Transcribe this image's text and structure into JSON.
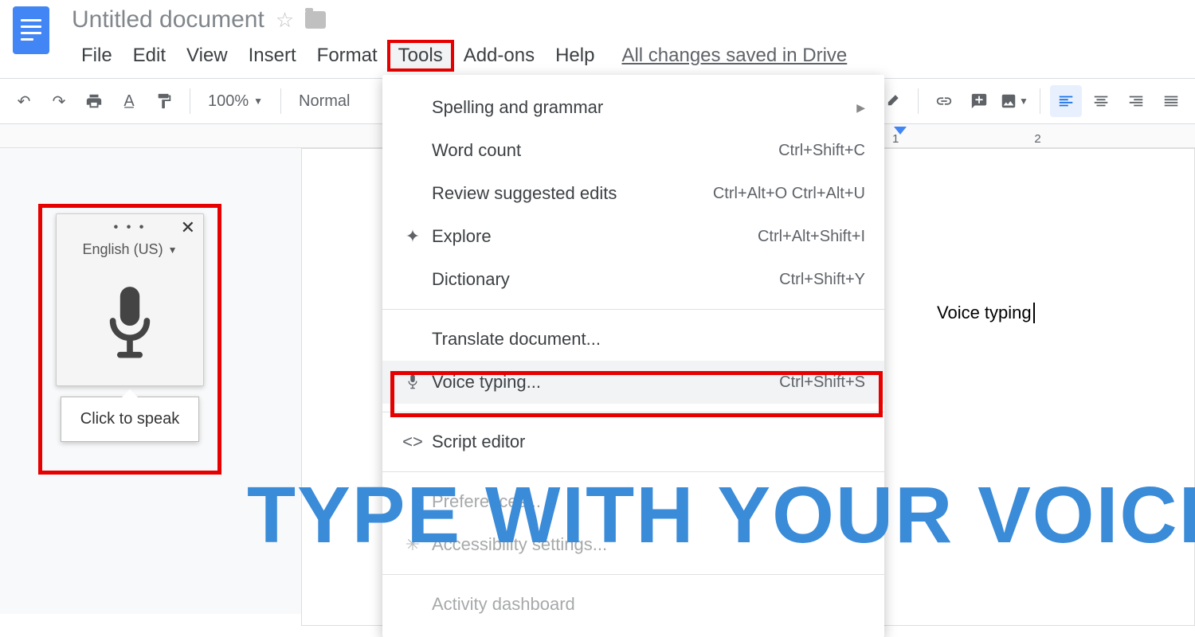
{
  "header": {
    "title": "Untitled document",
    "menus": [
      "File",
      "Edit",
      "View",
      "Insert",
      "Format",
      "Tools",
      "Add-ons",
      "Help"
    ],
    "saved": "All changes saved in Drive"
  },
  "toolbar": {
    "zoom": "100%",
    "style": "Normal"
  },
  "ruler": {
    "marks": [
      "1",
      "2"
    ]
  },
  "voiceWidget": {
    "language": "English (US)",
    "tooltip": "Click to speak"
  },
  "toolsMenu": {
    "items": [
      {
        "label": "Spelling and grammar",
        "shortcut": "",
        "arrow": true,
        "icon": ""
      },
      {
        "label": "Word count",
        "shortcut": "Ctrl+Shift+C",
        "icon": ""
      },
      {
        "label": "Review suggested edits",
        "shortcut": "Ctrl+Alt+O Ctrl+Alt+U",
        "icon": ""
      },
      {
        "label": "Explore",
        "shortcut": "Ctrl+Alt+Shift+I",
        "icon": "✦"
      },
      {
        "label": "Dictionary",
        "shortcut": "Ctrl+Shift+Y",
        "icon": ""
      }
    ],
    "items2": [
      {
        "label": "Translate document...",
        "shortcut": "",
        "icon": ""
      },
      {
        "label": "Voice typing...",
        "shortcut": "Ctrl+Shift+S",
        "icon": "mic",
        "hover": true
      }
    ],
    "items3": [
      {
        "label": "Script editor",
        "shortcut": "",
        "icon": "<>"
      }
    ],
    "items4": [
      {
        "label": "Preferences...",
        "dim": true
      },
      {
        "label": "Accessibility settings...",
        "dim": true
      }
    ],
    "items5": [
      {
        "label": "Activity dashboard",
        "dim": true
      }
    ]
  },
  "document": {
    "text": "Voice typing"
  },
  "overlay": "TYPE WITH YOUR VOICE"
}
